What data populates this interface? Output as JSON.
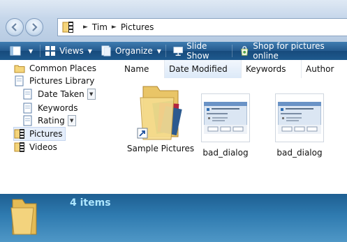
{
  "address": {
    "crumbs": [
      "Tim",
      "Pictures"
    ]
  },
  "toolbar": {
    "views_label": "Views",
    "organize_label": "Organize",
    "slideshow_label": "Slide Show",
    "shop_label": "Shop for pictures online"
  },
  "nav": {
    "common_places": "Common Places",
    "pictures_library": "Pictures Library",
    "date_taken": "Date Taken",
    "keywords": "Keywords",
    "rating": "Rating",
    "pictures": "Pictures",
    "videos": "Videos"
  },
  "columns": [
    "Name",
    "Date Modified",
    "Keywords",
    "Author"
  ],
  "files": [
    {
      "name": "Sample Pictures",
      "icon": "folder-shortcut-icon"
    },
    {
      "name": "bad_dialog",
      "icon": "dialog-thumbnail"
    },
    {
      "name": "bad_dialog",
      "icon": "dialog-thumbnail"
    }
  ],
  "status": {
    "item_count": "4 items"
  },
  "colors": {
    "toolbar": "#245a8e",
    "details": "#2f7bb0",
    "count_text": "#aee7ff"
  }
}
